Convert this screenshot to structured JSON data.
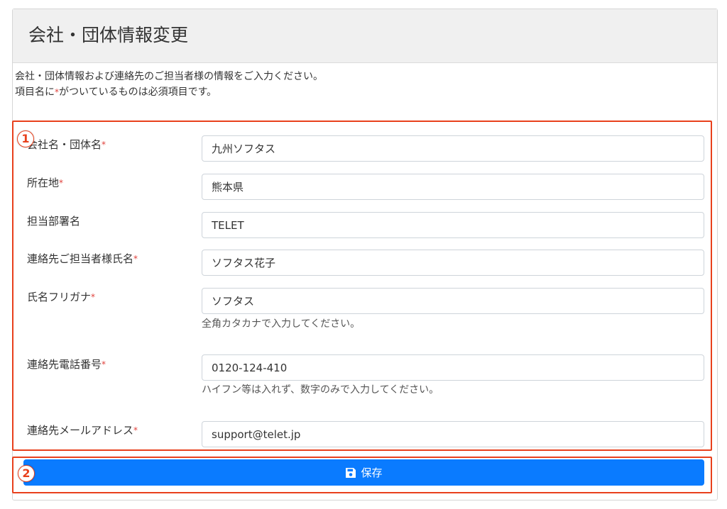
{
  "header": {
    "title": "会社・団体情報変更"
  },
  "intro": {
    "line1": "会社・団体情報および連絡先のご担当者様の情報をご入力ください。",
    "line2_before": "項目名に",
    "line2_after": "がついているものは必須項目です。",
    "required_mark": "*"
  },
  "annotations": {
    "badge1": "1",
    "badge2": "2"
  },
  "colors": {
    "highlight": "#e8401c",
    "primary_button": "#0a7bff",
    "required_mark": "#e0423c"
  },
  "fields": [
    {
      "label": "会社名・団体名",
      "required": "*",
      "value": "九州ソフタス"
    },
    {
      "label": "所在地",
      "required": "*",
      "value": "熊本県"
    },
    {
      "label": "担当部署名",
      "required": "",
      "value": "TELET"
    },
    {
      "label": "連絡先ご担当者様氏名",
      "required": "*",
      "value": "ソフタス花子"
    },
    {
      "label": "氏名フリガナ",
      "required": "*",
      "value": "ソフタス",
      "help": "全角カタカナで入力してください。"
    },
    {
      "label": "連絡先電話番号",
      "required": "*",
      "value": "0120-124-410",
      "help": "ハイフン等は入れず、数字のみで入力してください。"
    },
    {
      "label": "連絡先メールアドレス",
      "required": "*",
      "value": "support@telet.jp"
    }
  ],
  "save_button": {
    "label": "保存",
    "icon": "floppy-disk-icon"
  }
}
